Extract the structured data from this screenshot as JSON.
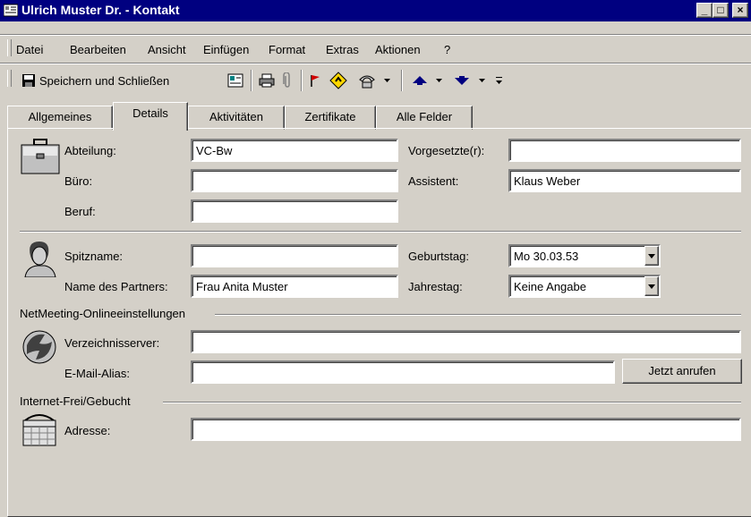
{
  "window": {
    "title": "Ulrich Muster Dr. - Kontakt"
  },
  "menu": {
    "items": [
      "Datei",
      "Bearbeiten",
      "Ansicht",
      "Einfügen",
      "Format",
      "Extras",
      "Aktionen",
      "?"
    ]
  },
  "toolbar": {
    "save_close_label": "Speichern und Schließen"
  },
  "tabs": [
    "Allgemeines",
    "Details",
    "Aktivitäten",
    "Zertifikate",
    "Alle Felder"
  ],
  "details": {
    "abteilung": {
      "label": "Abteilung:",
      "value": "VC-Bw"
    },
    "buero": {
      "label": "Büro:",
      "value": ""
    },
    "beruf": {
      "label": "Beruf:",
      "value": ""
    },
    "vorgesetzte": {
      "label": "Vorgesetzte(r):",
      "value": ""
    },
    "assistent": {
      "label": "Assistent:",
      "value": "Klaus Weber"
    },
    "spitzname": {
      "label": "Spitzname:",
      "value": ""
    },
    "partner": {
      "label": "Name des Partners:",
      "value": "Frau Anita Muster"
    },
    "geburtstag": {
      "label": "Geburtstag:",
      "value": "Mo 30.03.53"
    },
    "jahrestag": {
      "label": "Jahrestag:",
      "value": "Keine Angabe"
    },
    "netmeeting_heading": "NetMeeting-Onlineeinstellungen",
    "verzeichnisserver": {
      "label": "Verzeichnisserver:",
      "value": ""
    },
    "email_alias": {
      "label": "E-Mail-Alias:",
      "value": ""
    },
    "call_button": "Jetzt anrufen",
    "freebusy_heading": "Internet-Frei/Gebucht",
    "adresse": {
      "label": "Adresse:",
      "value": ""
    }
  }
}
